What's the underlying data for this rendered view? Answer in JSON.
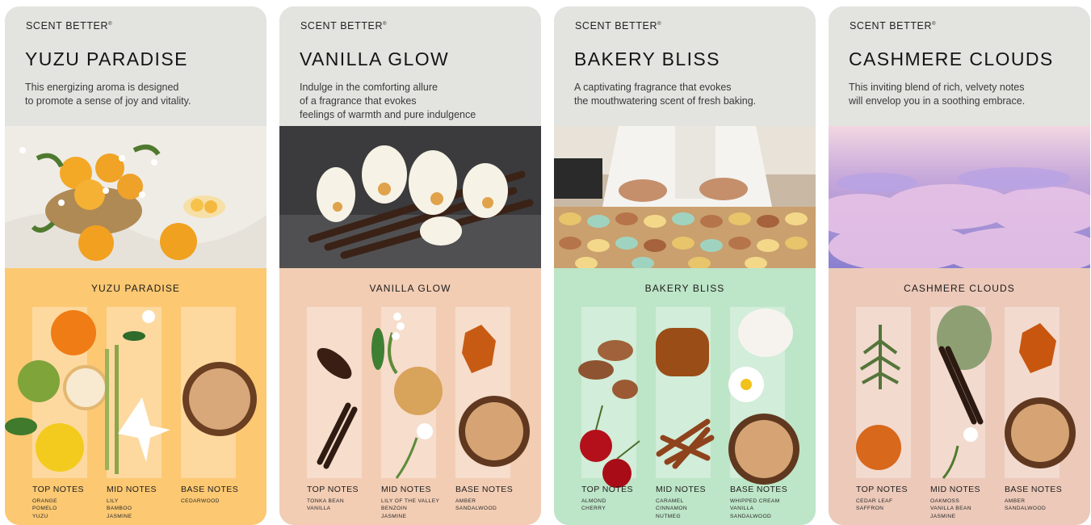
{
  "cards": [
    {
      "brand": "SCENT BETTER",
      "brand_mark": "®",
      "title": "YUZU PARADISE",
      "description": [
        "This energizing aroma is designed",
        "to promote a sense of joy and vitality."
      ],
      "notes_title": "YUZU PARADISE",
      "photo_subject": "yuzu-fruit-basket-photo",
      "notes_bg": "#fcc872",
      "top_notes": {
        "label": "TOP NOTES",
        "items": [
          "ORANGE",
          "POMELO",
          "YUZU"
        ]
      },
      "mid_notes": {
        "label": "MID NOTES",
        "items": [
          "LILY",
          "BAMBOO",
          "JASMINE"
        ]
      },
      "base_notes": {
        "label": "BASE NOTES",
        "items": [
          "CEDARWOOD"
        ]
      }
    },
    {
      "brand": "SCENT BETTER",
      "brand_mark": "®",
      "title": "VANILLA GLOW",
      "description": [
        "Indulge in the comforting allure",
        "of a fragrance that evokes",
        "feelings of warmth and pure indulgence"
      ],
      "notes_title": "VANILLA GLOW",
      "photo_subject": "vanilla-orchid-photo",
      "notes_bg": "#f2cdb4",
      "top_notes": {
        "label": "TOP NOTES",
        "items": [
          "TONKA BEAN",
          "VANILLA"
        ]
      },
      "mid_notes": {
        "label": "MID NOTES",
        "items": [
          "LILY OF THE VALLEY",
          "BENZOIN",
          "JASMINE"
        ]
      },
      "base_notes": {
        "label": "BASE NOTES",
        "items": [
          "AMBER",
          "SANDALWOOD"
        ]
      }
    },
    {
      "brand": "SCENT BETTER",
      "brand_mark": "®",
      "title": "BAKERY BLISS",
      "description": [
        "A captivating fragrance that evokes",
        "the mouthwatering scent of fresh baking."
      ],
      "notes_title": "BAKERY BLISS",
      "photo_subject": "baker-macarons-photo",
      "notes_bg": "#bde5c7",
      "top_notes": {
        "label": "TOP NOTES",
        "items": [
          "ALMOND",
          "CHERRY"
        ]
      },
      "mid_notes": {
        "label": "MID NOTES",
        "items": [
          "CARAMEL",
          "CINNAMON",
          "NUTMEG"
        ]
      },
      "base_notes": {
        "label": "BASE NOTES",
        "items": [
          "WHIPPED CREAM",
          "VANILLA",
          "SANDALWOOD"
        ]
      }
    },
    {
      "brand": "SCENT BETTER",
      "brand_mark": "®",
      "title": "CASHMERE CLOUDS",
      "description": [
        "This inviting blend of rich, velvety notes",
        "will envelop you in a soothing embrace."
      ],
      "notes_title": "CASHMERE CLOUDS",
      "photo_subject": "pastel-clouds-photo",
      "notes_bg": "#ecc9b9",
      "top_notes": {
        "label": "TOP NOTES",
        "items": [
          "CEDAR LEAF",
          "SAFFRON"
        ]
      },
      "mid_notes": {
        "label": "MID NOTES",
        "items": [
          "OAKMOSS",
          "VANILLA BEAN",
          "JASMINE"
        ]
      },
      "base_notes": {
        "label": "BASE NOTES",
        "items": [
          "AMBER",
          "SANDALWOOD"
        ]
      }
    }
  ]
}
